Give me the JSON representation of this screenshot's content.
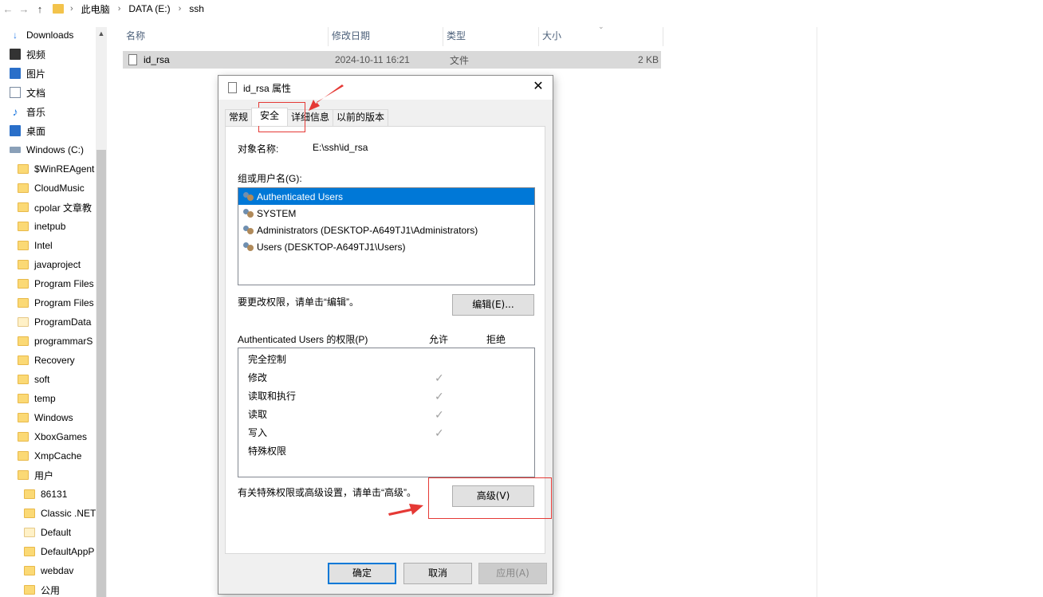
{
  "address": {
    "back": "←",
    "forward": "→",
    "up": "↑",
    "crumbs": [
      "此电脑",
      "DATA (E:)",
      "ssh"
    ]
  },
  "sidebar": {
    "items": [
      {
        "label": "Downloads",
        "icon": "download-arrow-icon"
      },
      {
        "label": "视频",
        "icon": "video-icon"
      },
      {
        "label": "图片",
        "icon": "pictures-icon"
      },
      {
        "label": "文档",
        "icon": "documents-icon"
      },
      {
        "label": "音乐",
        "icon": "music-icon"
      },
      {
        "label": "桌面",
        "icon": "desktop-icon"
      },
      {
        "label": "Windows (C:)",
        "icon": "drive-icon"
      },
      {
        "label": "$WinREAgent",
        "icon": "folder-icon"
      },
      {
        "label": "CloudMusic",
        "icon": "folder-icon"
      },
      {
        "label": "cpolar 文章教",
        "icon": "folder-icon"
      },
      {
        "label": "inetpub",
        "icon": "folder-icon"
      },
      {
        "label": "Intel",
        "icon": "folder-icon"
      },
      {
        "label": "javaproject",
        "icon": "folder-icon"
      },
      {
        "label": "Program Files",
        "icon": "folder-icon"
      },
      {
        "label": "Program Files",
        "icon": "folder-icon"
      },
      {
        "label": "ProgramData",
        "icon": "folder-icon"
      },
      {
        "label": "programmarS",
        "icon": "folder-icon"
      },
      {
        "label": "Recovery",
        "icon": "folder-icon"
      },
      {
        "label": "soft",
        "icon": "folder-icon"
      },
      {
        "label": "temp",
        "icon": "folder-icon"
      },
      {
        "label": "Windows",
        "icon": "folder-icon"
      },
      {
        "label": "XboxGames",
        "icon": "folder-icon"
      },
      {
        "label": "XmpCache",
        "icon": "folder-icon"
      },
      {
        "label": "用户",
        "icon": "folder-icon"
      },
      {
        "label": "86131",
        "icon": "folder-icon"
      },
      {
        "label": "Classic .NET",
        "icon": "folder-icon"
      },
      {
        "label": "Default",
        "icon": "folder-icon"
      },
      {
        "label": "DefaultAppP",
        "icon": "folder-icon"
      },
      {
        "label": "webdav",
        "icon": "folder-icon"
      },
      {
        "label": "公用",
        "icon": "folder-icon"
      }
    ]
  },
  "filelist": {
    "columns": [
      "名称",
      "修改日期",
      "类型",
      "大小"
    ],
    "rows": [
      {
        "name": "id_rsa",
        "modified": "2024-10-11 16:21",
        "type": "文件",
        "size": "2 KB"
      }
    ]
  },
  "dialog": {
    "title": "id_rsa 属性",
    "close": "✕",
    "tabs": [
      "常规",
      "安全",
      "详细信息",
      "以前的版本"
    ],
    "object_label": "对象名称:",
    "object_value": "E:\\ssh\\id_rsa",
    "group_label": "组或用户名(G):",
    "users": [
      "Authenticated Users",
      "SYSTEM",
      "Administrators (DESKTOP-A649TJ1\\Administrators)",
      "Users (DESKTOP-A649TJ1\\Users)"
    ],
    "change_hint": "要更改权限，请单击“编辑”。",
    "edit_button": "编辑(E)...",
    "perm_label": "Authenticated Users 的权限(P)",
    "allow_header": "允许",
    "deny_header": "拒绝",
    "permissions": [
      {
        "name": "完全控制",
        "allow": false
      },
      {
        "name": "修改",
        "allow": true
      },
      {
        "name": "读取和执行",
        "allow": true
      },
      {
        "name": "读取",
        "allow": true
      },
      {
        "name": "写入",
        "allow": true
      },
      {
        "name": "特殊权限",
        "allow": false
      }
    ],
    "check_mark": "✓",
    "advanced_hint": "有关特殊权限或高级设置，请单击“高级”。",
    "advanced_button": "高级(V)",
    "ok_button": "确定",
    "cancel_button": "取消",
    "apply_button": "应用(A)"
  },
  "colors": {
    "selection": "#0078d7",
    "annotation": "#e53935"
  }
}
